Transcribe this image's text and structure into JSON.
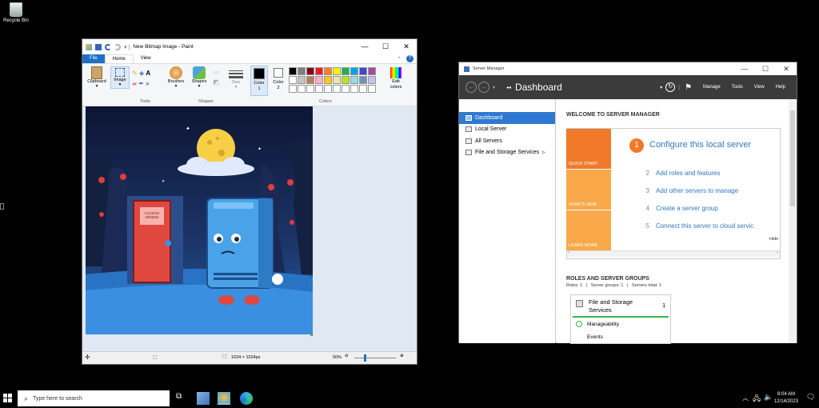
{
  "desktop": {
    "recycle_bin": "Recycle Bin"
  },
  "paint": {
    "title": "New Bitmap Image - Paint",
    "tabs": [
      "File",
      "Home",
      "View"
    ],
    "buttons": {
      "clipboard": "Clipboard",
      "image": "Image",
      "brushes": "Brushes",
      "shapes": "Shapes",
      "size": "Size",
      "color1": "Color\n1",
      "color2": "Color\n2",
      "edit_colors": "Edit\ncolors"
    },
    "groups": {
      "tools": "Tools",
      "shapes": "Shapes",
      "colors": "Colors"
    },
    "palette_row1": [
      "#000000",
      "#7f7f7f",
      "#880015",
      "#ed1c24",
      "#ff7f27",
      "#fff200",
      "#22b14c",
      "#00a2e8",
      "#3f48cc",
      "#a349a4"
    ],
    "palette_row2": [
      "#ffffff",
      "#c3c3c3",
      "#b97a57",
      "#ffaec9",
      "#ffc90e",
      "#efe4b0",
      "#b5e61d",
      "#99d9ea",
      "#7092be",
      "#c8bfe7"
    ],
    "canvas_sign": "ACCESS\nDENIED",
    "status": {
      "dimensions": "1024 × 1024px",
      "zoom": "50%"
    }
  },
  "server_manager": {
    "window_title": "Server Manager",
    "header_title": "Dashboard",
    "menu": [
      "Manage",
      "Tools",
      "View",
      "Help"
    ],
    "nav": [
      "Dashboard",
      "Local Server",
      "All Servers",
      "File and Storage Services"
    ],
    "welcome_title": "WELCOME TO SERVER MANAGER",
    "tiles": [
      "QUICK START",
      "WHAT'S NEW",
      "LEARN MORE"
    ],
    "configure": {
      "num": "1",
      "label": "Configure this local server"
    },
    "steps": [
      {
        "num": "2",
        "label": "Add roles and features"
      },
      {
        "num": "3",
        "label": "Add other servers to manage"
      },
      {
        "num": "4",
        "label": "Create a server group"
      },
      {
        "num": "5",
        "label": "Connect this server to cloud servic"
      }
    ],
    "hide": "Hide",
    "roles_title": "ROLES AND SERVER GROUPS",
    "roles_summary": "Roles: 1   |   Server groups: 1   |   Servers total: 1",
    "role_card": {
      "name": "File and Storage Services",
      "count": "1",
      "manageability": "Manageability",
      "events": "Events"
    }
  },
  "taskbar": {
    "search_placeholder": "Type here to search",
    "time": "8:04 AM",
    "date": "12/14/2023"
  },
  "colors": {
    "accent": "#2f7ad0",
    "sm_orange": "#f07a2a",
    "sm_orange_light": "#f9a94a"
  }
}
